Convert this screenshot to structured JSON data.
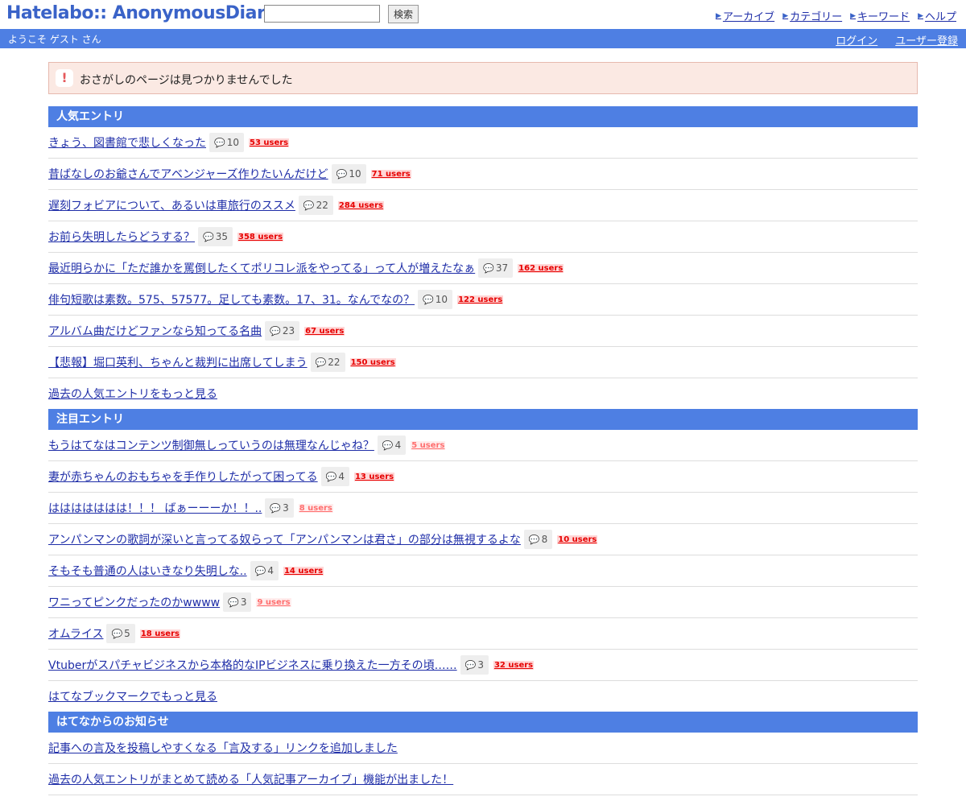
{
  "header": {
    "logo": "Hatelabo:: AnonymousDiary",
    "search_placeholder": "",
    "search_button": "検索",
    "nav": [
      "アーカイブ",
      "カテゴリー",
      "キーワード",
      "ヘルプ"
    ]
  },
  "bar": {
    "welcome": "ようこそ ゲスト さん",
    "login": "ログイン",
    "register": "ユーザー登録"
  },
  "alert": {
    "message": "おさがしのページは見つかりませんでした"
  },
  "popular": {
    "heading": "人気エントリ",
    "entries": [
      {
        "title": "きょう、図書館で悲しくなった",
        "comments": "10",
        "users": "53 users"
      },
      {
        "title": "昔ばなしのお爺さんでアベンジャーズ作りたいんだけど",
        "comments": "10",
        "users": "71 users"
      },
      {
        "title": "遅刻フォビアについて、あるいは車旅行のススメ",
        "comments": "22",
        "users": "284 users"
      },
      {
        "title": "お前ら失明したらどうする？",
        "comments": "35",
        "users": "358 users"
      },
      {
        "title": "最近明らかに「ただ誰かを罵倒したくてポリコレ派をやってる」って人が増えたなぁ",
        "comments": "37",
        "users": "162 users"
      },
      {
        "title": "俳句短歌は素数。575、57577。足しても素数。17、31。なんでなの？",
        "comments": "10",
        "users": "122 users"
      },
      {
        "title": "アルバム曲だけどファンなら知ってる名曲",
        "comments": "23",
        "users": "67 users"
      },
      {
        "title": "【悲報】堀口英利、ちゃんと裁判に出席してしまう",
        "comments": "22",
        "users": "150 users"
      }
    ],
    "more": "過去の人気エントリをもっと見る"
  },
  "hot": {
    "heading": "注目エントリ",
    "entries": [
      {
        "title": "もうはてなはコンテンツ制御無しっていうのは無理なんじゃね？",
        "comments": "4",
        "users": "5 users",
        "light": true
      },
      {
        "title": "妻が赤ちゃんのおもちゃを手作りしたがって困ってる",
        "comments": "4",
        "users": "13 users",
        "light": false
      },
      {
        "title": "ははははははは！！！ ばぁーーーか！！..",
        "comments": "3",
        "users": "8 users",
        "light": true
      },
      {
        "title": "アンパンマンの歌詞が深いと言ってる奴らって「アンパンマンは君さ」の部分は無視するよな",
        "comments": "8",
        "users": "10 users",
        "light": false
      },
      {
        "title": "そもそも普通の人はいきなり失明しな..",
        "comments": "4",
        "users": "14 users",
        "light": false
      },
      {
        "title": "ワニってピンクだったのかwwww",
        "comments": "3",
        "users": "9 users",
        "light": true
      },
      {
        "title": "オムライス",
        "comments": "5",
        "users": "18 users",
        "light": false
      },
      {
        "title": "Vtuberがスパチャビジネスから本格的なIPビジネスに乗り換えた一方その頃……",
        "comments": "3",
        "users": "32 users",
        "light": false
      }
    ],
    "more": "はてなブックマークでもっと見る"
  },
  "news": {
    "heading": "はてなからのお知らせ",
    "entries": [
      "記事への言及を投稿しやすくなる「言及する」リンクを追加しました",
      "過去の人気エントリがまとめて読める「人気記事アーカイブ」機能が出ました！"
    ]
  }
}
